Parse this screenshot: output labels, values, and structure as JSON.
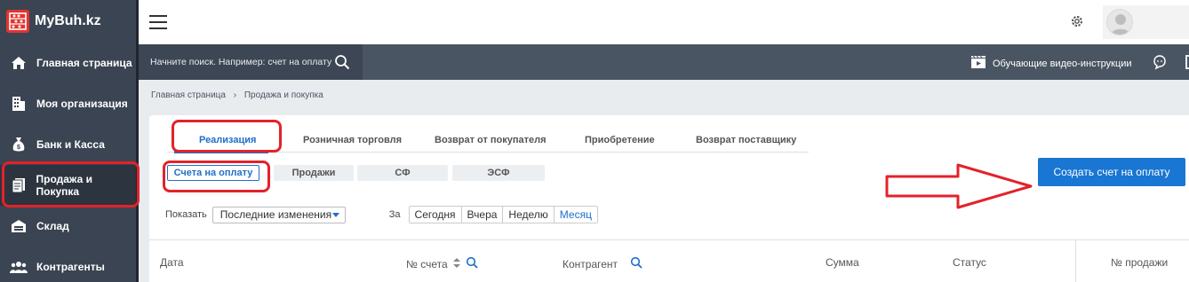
{
  "app": {
    "name": "MyBuh.kz"
  },
  "sidebar": {
    "items": [
      {
        "label": "Главная страница",
        "icon": "home-icon"
      },
      {
        "label": "Моя организация",
        "icon": "building-icon"
      },
      {
        "label": "Банк и Касса",
        "icon": "money-bag-icon"
      },
      {
        "label": "Продажа и Покупка",
        "icon": "document-icon",
        "active": true
      },
      {
        "label": "Склад",
        "icon": "warehouse-icon"
      },
      {
        "label": "Контрагенты",
        "icon": "people-icon"
      }
    ]
  },
  "search": {
    "placeholder": "Начните поиск. Например: счет на оплату"
  },
  "header": {
    "video_link": "Обучающие видео-инструкции"
  },
  "breadcrumb": {
    "home": "Главная страница",
    "current": "Продажа и покупка"
  },
  "tabs": [
    {
      "label": "Реализация",
      "active": true
    },
    {
      "label": "Розничная торговля"
    },
    {
      "label": "Возврат от покупателя"
    },
    {
      "label": "Приобретение"
    },
    {
      "label": "Возврат поставщику"
    }
  ],
  "subtabs": [
    {
      "label": "Счета на оплату",
      "active": true
    },
    {
      "label": "Продажи"
    },
    {
      "label": "СФ"
    },
    {
      "label": "ЭСФ"
    }
  ],
  "create_button": "Создать счет на оплату",
  "filters": {
    "show_label": "Показать",
    "show_value": "Последние изменения",
    "period_label": "За",
    "periods": [
      "Сегодня",
      "Вчера",
      "Неделю",
      "Месяц"
    ],
    "selected_period": "Месяц"
  },
  "table": {
    "columns": [
      "Дата",
      "№ счета",
      "Контрагент",
      "Сумма",
      "Статус",
      "№ продажи"
    ]
  },
  "colors": {
    "accent": "#1976d2",
    "annotation": "#e3222a",
    "sidebar": "#3a4452"
  }
}
